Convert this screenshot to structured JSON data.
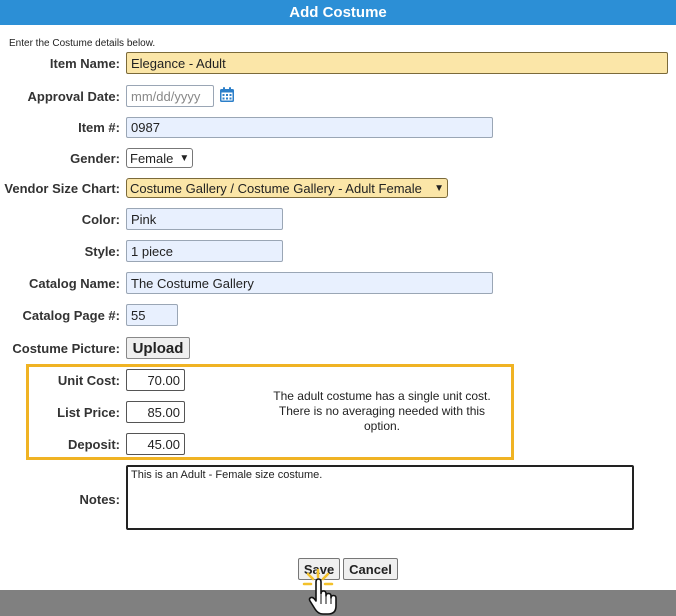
{
  "title": "Add Costume",
  "instructions": "Enter the Costume details below.",
  "fields": {
    "item_name": {
      "label": "Item Name:",
      "value": "Elegance - Adult"
    },
    "approval_date": {
      "label": "Approval Date:",
      "placeholder": "mm/dd/yyyy"
    },
    "item_number": {
      "label": "Item #:",
      "value": "0987"
    },
    "gender": {
      "label": "Gender:",
      "value": "Female"
    },
    "vendor_size_chart": {
      "label": "Vendor Size Chart:",
      "value": "Costume Gallery / Costume Gallery - Adult Female"
    },
    "color": {
      "label": "Color:",
      "value": "Pink"
    },
    "style": {
      "label": "Style:",
      "value": "1 piece"
    },
    "catalog_name": {
      "label": "Catalog Name:",
      "value": "The Costume Gallery"
    },
    "catalog_page": {
      "label": "Catalog Page #:",
      "value": "55"
    },
    "costume_picture": {
      "label": "Costume Picture:",
      "button": "Upload"
    },
    "unit_cost": {
      "label": "Unit Cost:",
      "value": "70.00"
    },
    "list_price": {
      "label": "List Price:",
      "value": "85.00"
    },
    "deposit": {
      "label": "Deposit:",
      "value": "45.00"
    },
    "notes": {
      "label": "Notes:",
      "value": "This is an Adult - Female size costume."
    }
  },
  "callout": "The adult costume has a single unit cost. There is no averaging needed with this option.",
  "buttons": {
    "save": "Save",
    "cancel": "Cancel"
  },
  "colors": {
    "titlebar": "#2c8fd6",
    "highlight_box": "#f0b323",
    "required_field": "#fbe6a8",
    "footer": "#808080"
  },
  "icons": {
    "date_picker": "calendar-icon",
    "cursor": "hand-pointer-cursor"
  }
}
